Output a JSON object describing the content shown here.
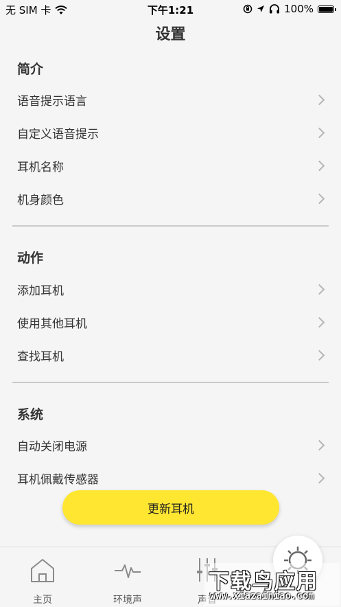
{
  "status_bar": {
    "carrier": "无 SIM 卡",
    "time": "下午1:21",
    "battery": "100%",
    "battery_level": 1.0
  },
  "nav": {
    "title": "设置"
  },
  "sections": [
    {
      "title": "简介",
      "items": [
        "语音提示语言",
        "自定义语音提示",
        "耳机名称",
        "机身颜色"
      ]
    },
    {
      "title": "动作",
      "items": [
        "添加耳机",
        "使用其他耳机",
        "查找耳机"
      ]
    },
    {
      "title": "系统",
      "items": [
        "自动关闭电源",
        "耳机佩戴传感器"
      ]
    }
  ],
  "update_button": {
    "label": "更新耳机"
  },
  "tab_bar": {
    "tabs": [
      {
        "label": "主页",
        "icon": "home-icon"
      },
      {
        "label": "环境声",
        "icon": "waveform-icon"
      },
      {
        "label": "声音",
        "icon": "equalizer-icon"
      }
    ]
  },
  "watermark": {
    "main": "下载鸟应用",
    "url": "www.xiazainiao.com"
  }
}
